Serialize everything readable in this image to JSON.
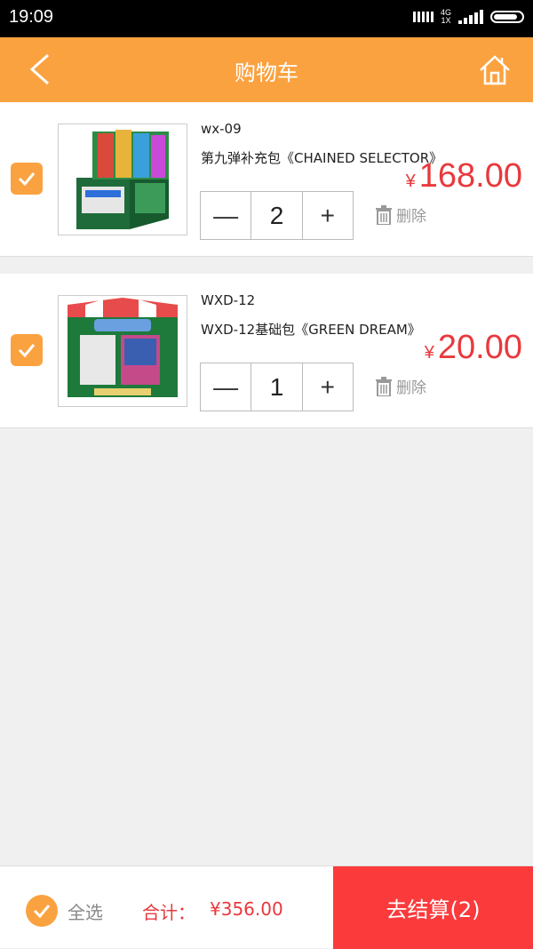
{
  "status_bar": {
    "time": "19:09",
    "network_line1": "4G",
    "network_line2": "1X"
  },
  "header": {
    "title": "购物车",
    "back_icon": "back-arrow-icon",
    "home_icon": "home-icon",
    "background": "#fba240"
  },
  "cart": {
    "items": [
      {
        "code": "wx-09",
        "name": "第九弹补充包《CHAINED SELECTOR》",
        "currency": "¥",
        "price": "168.00",
        "quantity": "2",
        "minus": "—",
        "plus": "+",
        "delete_label": "删除",
        "checked": true
      },
      {
        "code": "WXD-12",
        "name": "WXD-12基础包《GREEN DREAM》",
        "currency": "¥",
        "price": "20.00",
        "quantity": "1",
        "minus": "—",
        "plus": "+",
        "delete_label": "删除",
        "checked": true
      }
    ]
  },
  "footer": {
    "select_all_label": "全选",
    "total_label": "合计：",
    "total_value": "¥356.00",
    "checkout_label": "去结算(2)"
  },
  "colors": {
    "accent": "#fba240",
    "price": "#e8393d",
    "checkout": "#fb3a3c"
  }
}
